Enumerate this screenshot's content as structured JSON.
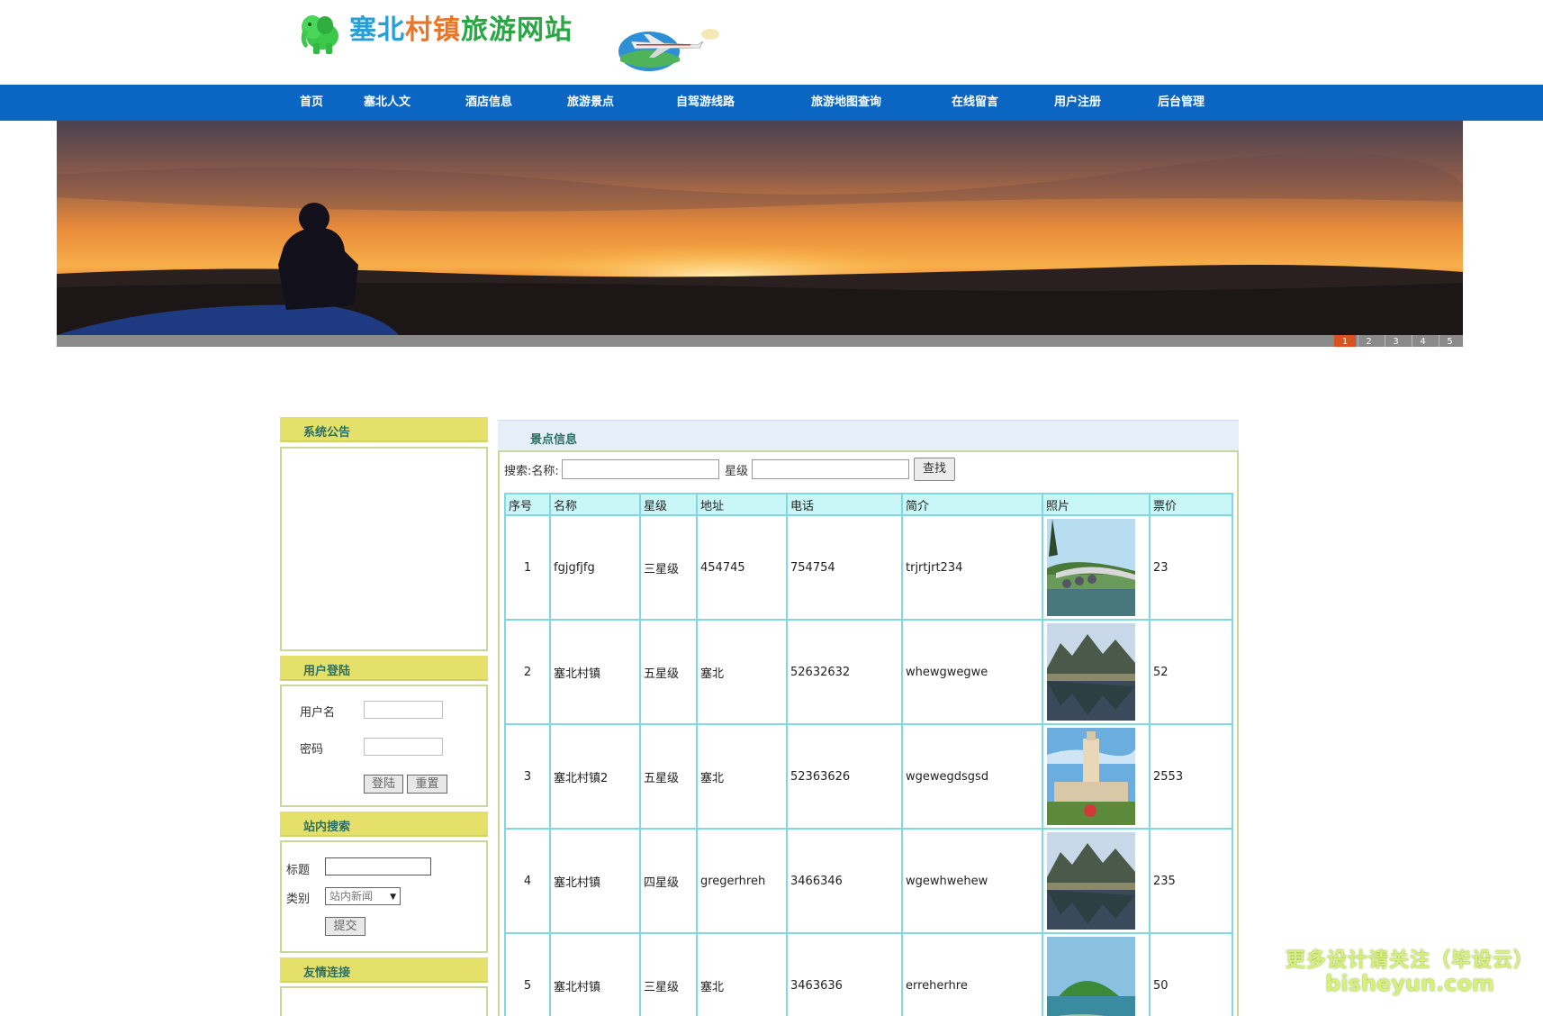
{
  "site": {
    "title_part1": "塞北",
    "title_part2": "村镇",
    "title_part3": "旅游网站"
  },
  "nav": [
    {
      "label": "首页",
      "icon": ""
    },
    {
      "label": "塞北人文"
    },
    {
      "label": "酒店信息"
    },
    {
      "label": "旅游景点"
    },
    {
      "label": "自驾游线路"
    },
    {
      "label": "旅游地图查询"
    },
    {
      "label": "在线留言"
    },
    {
      "label": "用户注册"
    },
    {
      "label": "后台管理"
    }
  ],
  "slider": {
    "pages": [
      "1",
      "2",
      "3",
      "4",
      "5"
    ],
    "active_page": 1
  },
  "sidebar": {
    "announcement_title": "系统公告",
    "login_title": "用户登陆",
    "username_label": "用户名",
    "password_label": "密码",
    "login_button": "登陆",
    "reset_button": "重置",
    "search_title": "站内搜索",
    "search_title_label": "标题",
    "search_category_label": "类别",
    "search_category_value": "站内新闻",
    "submit_button": "提交",
    "links_title": "友情连接"
  },
  "main": {
    "title": "景点信息",
    "search_name_label": "搜索:名称:",
    "search_star_label": "星级",
    "search_button": "查找",
    "columns": [
      "序号",
      "名称",
      "星级",
      "地址",
      "电话",
      "简介",
      "照片",
      "票价"
    ],
    "rows": [
      {
        "no": "1",
        "name": "fgjgfjfg",
        "star": "三星级",
        "address": "454745",
        "phone": "754754",
        "intro": "trjrtjrt234",
        "photo": "bridge-photo",
        "price": "23"
      },
      {
        "no": "2",
        "name": "塞北村镇",
        "star": "五星级",
        "address": "塞北",
        "phone": "52632632",
        "intro": "whewgwegwe",
        "photo": "mountain-lake-photo",
        "price": "52"
      },
      {
        "no": "3",
        "name": "塞北村镇2",
        "star": "五星级",
        "address": "塞北",
        "phone": "52363626",
        "intro": "wgewegdsgsd",
        "photo": "tower-building-photo",
        "price": "2553"
      },
      {
        "no": "4",
        "name": "塞北村镇",
        "star": "四星级",
        "address": "gregerhreh",
        "phone": "3466346",
        "intro": "wgewhwehew",
        "photo": "mountain-lake-photo",
        "price": "235"
      },
      {
        "no": "5",
        "name": "塞北村镇",
        "star": "三星级",
        "address": "塞北",
        "phone": "3463636",
        "intro": "erreherhre",
        "photo": "island-photo",
        "price": "50"
      }
    ]
  },
  "watermark": {
    "line1": "更多设计请关注（毕设云）",
    "line2": "bisheyun.com"
  },
  "colors": {
    "nav_bg": "#0a66c2",
    "side_head_bg": "#e5e06a",
    "table_border": "#7fd9e0",
    "table_head_bg": "#c9f7f7",
    "active_slide": "#d9531e"
  }
}
